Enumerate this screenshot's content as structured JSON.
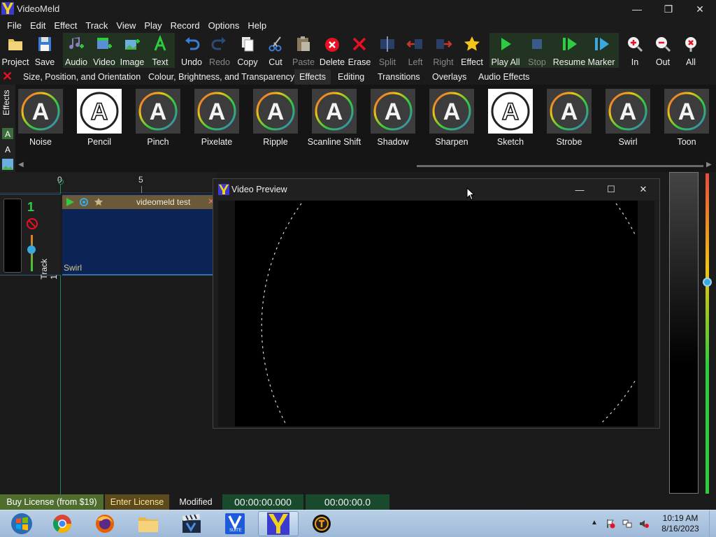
{
  "window": {
    "title": "VideoMeld",
    "minimize_glyph": "—",
    "maximize_glyph": "❐",
    "close_glyph": "✕"
  },
  "menu": [
    "File",
    "Edit",
    "Effect",
    "Track",
    "View",
    "Play",
    "Record",
    "Options",
    "Help"
  ],
  "toolbar": {
    "project": "Project",
    "save": "Save",
    "audio": "Audio",
    "video": "Video",
    "image": "Image",
    "text": "Text",
    "undo": "Undo",
    "redo": "Redo",
    "copy": "Copy",
    "cut": "Cut",
    "paste": "Paste",
    "delete": "Delete",
    "erase": "Erase",
    "split": "Split",
    "left": "Left",
    "right": "Right",
    "effect": "Effect",
    "play_all": "Play All",
    "stop": "Stop",
    "resume": "Resume",
    "marker": "Marker",
    "zoom_in": "In",
    "zoom_out": "Out",
    "zoom_all": "All"
  },
  "tabs": {
    "size": "Size, Position, and Orientation",
    "colour": "Colour, Brightness, and Transparency",
    "effects": "Effects",
    "editing": "Editing",
    "transitions": "Transitions",
    "overlays": "Overlays",
    "audio_effects": "Audio Effects"
  },
  "effects_panel": {
    "side_label": "Effects",
    "items": [
      "Noise",
      "Pencil",
      "Pinch",
      "Pixelate",
      "Ripple",
      "Scanline Shift",
      "Shadow",
      "Sharpen",
      "Sketch",
      "Strobe",
      "Swirl",
      "Toon"
    ],
    "thumb_letter": "A"
  },
  "timeline": {
    "ruler_zero": "0",
    "ruler_five": "5",
    "track_number": "1",
    "track_name": "Track 1",
    "clip_title": "videomeld test",
    "clip_effect": "Swirl"
  },
  "preview": {
    "title": "Video Preview",
    "minimize_glyph": "—",
    "maximize_glyph": "☐",
    "close_glyph": "✕"
  },
  "status": {
    "buy_license": "Buy License (from $19)",
    "enter_license": "Enter License",
    "modified": "Modified",
    "time_position": "00:00:00.000",
    "time_duration": "00:00:00.0",
    "colors": {
      "buy_bg": "#4f6e2e",
      "enter_bg": "#5a4a1e",
      "time_bg": "#1a4a2e"
    }
  },
  "taskbar": {
    "clock_time": "10:19 AM",
    "clock_date": "8/16/2023",
    "vsuite_label": "SUITE",
    "apps": [
      "start-orb",
      "chrome",
      "firefox",
      "file-explorer",
      "videoblocks",
      "vsuite",
      "videomeld",
      "timer"
    ]
  }
}
